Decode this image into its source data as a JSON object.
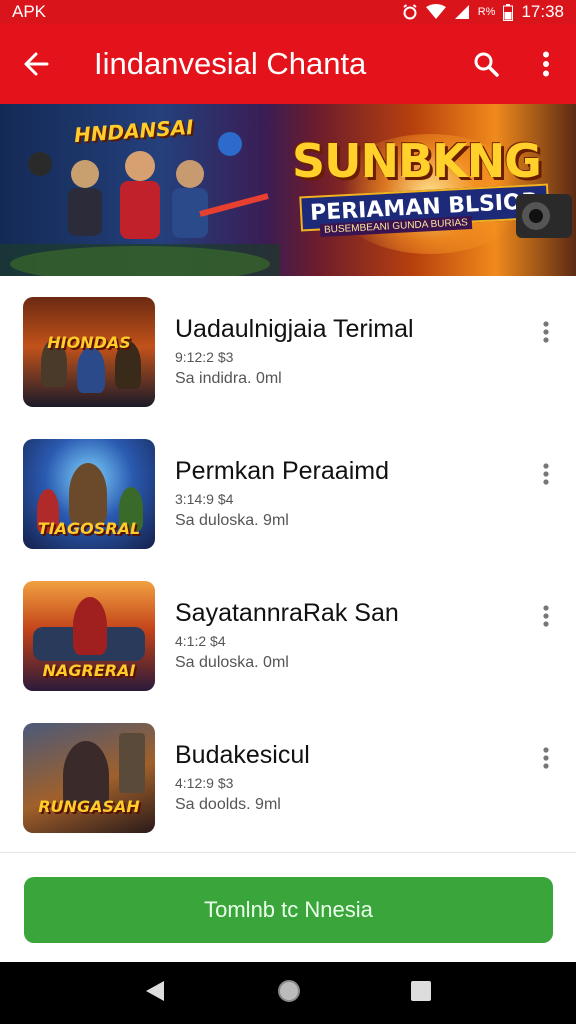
{
  "status_bar": {
    "left_label": "APK",
    "right_label": "R%",
    "time": "17:38"
  },
  "app_bar": {
    "title": "Iindanvesial Chanta",
    "icons": [
      "back-arrow-icon",
      "search-icon",
      "more-vert-icon"
    ]
  },
  "banner": {
    "left_text": "HNDANSAI",
    "headline": "SUNBKNG",
    "subheadline": "PERIAMAN BLSIOR",
    "tagline": "BUSEMBEANI GUNDA BURIAS"
  },
  "items": [
    {
      "title": "Uadaulnigjaia Terimal",
      "meta1": "9:12:2 $3",
      "meta2": "Sa indidra. 0ml",
      "thumb_text": "HIONDAS"
    },
    {
      "title": "Permkan Peraaimd",
      "meta1": "3:14:9 $4",
      "meta2": "Sa duloska. 9ml",
      "thumb_text": "TIAGOSRAL"
    },
    {
      "title": "SayatannraRak San",
      "meta1": "4:1:2 $4",
      "meta2": "Sa duloska. 0ml",
      "thumb_text": "NAGRERAI"
    },
    {
      "title": "Budakesicul",
      "meta1": "4:12:9 $3",
      "meta2": "Sa doolds. 9ml",
      "thumb_text": "RUNGASAH"
    }
  ],
  "cta": {
    "label": "Tomlnb tc Nnesia"
  },
  "nav_bar": {
    "icons": [
      "back-triangle-icon",
      "home-circle-icon",
      "recents-square-icon"
    ]
  },
  "colors": {
    "primary_red": "#e3121b",
    "cta_green": "#3aa53a"
  }
}
